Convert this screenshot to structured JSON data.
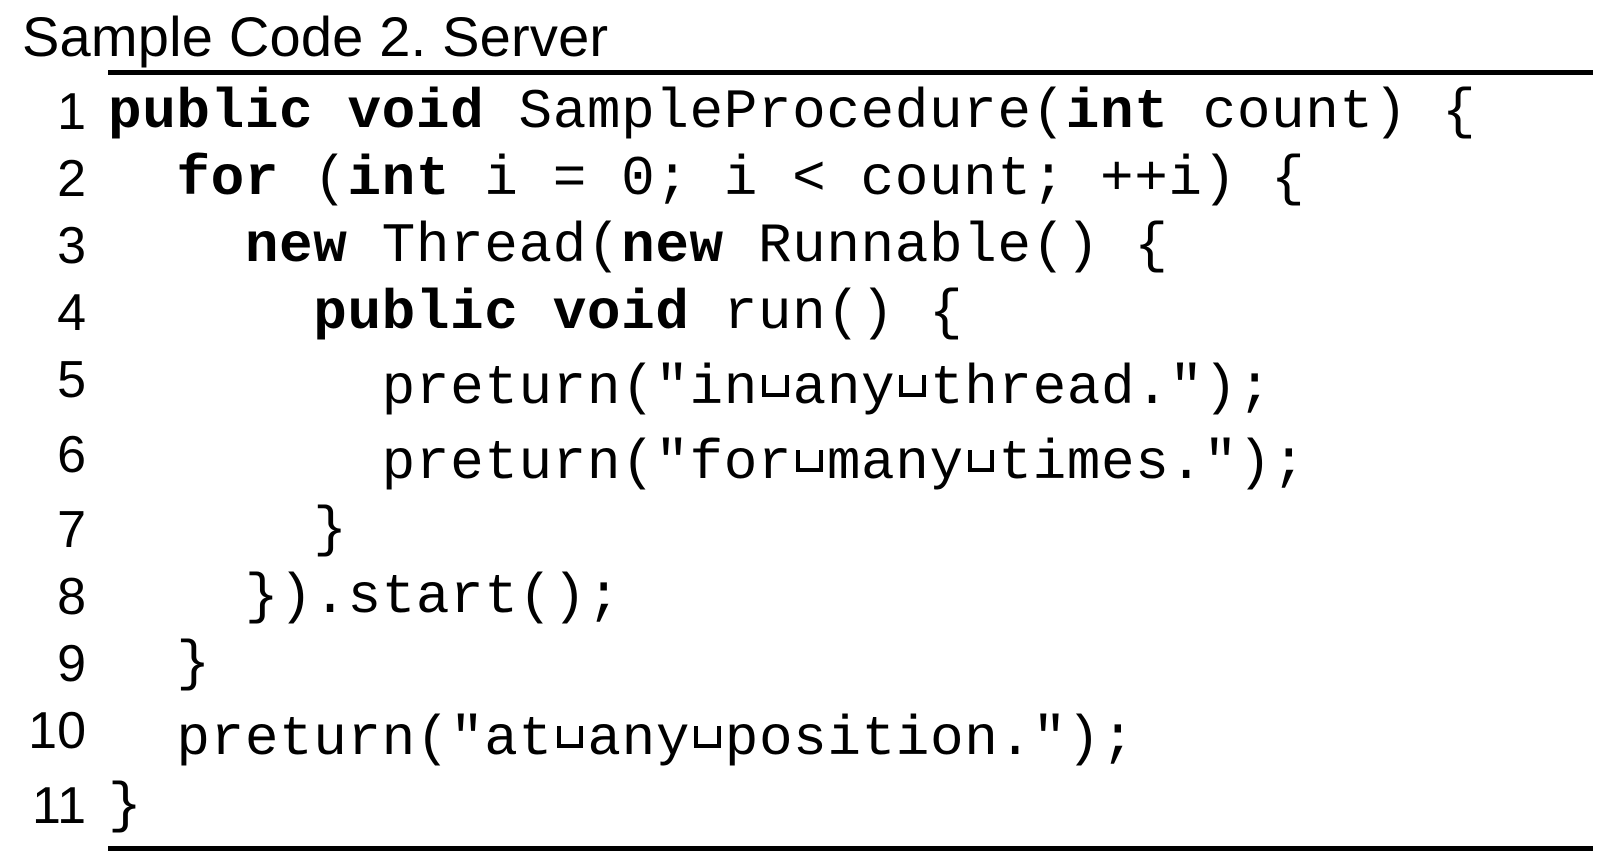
{
  "caption": "Sample Code 2.  Server",
  "code": {
    "lines": [
      {
        "n": 1,
        "indent": 0,
        "tokens": [
          {
            "t": "public",
            "kw": true
          },
          {
            "t": " "
          },
          {
            "t": "void",
            "kw": true
          },
          {
            "t": " SampleProcedure("
          },
          {
            "t": "int",
            "kw": true
          },
          {
            "t": " count) {"
          }
        ]
      },
      {
        "n": 2,
        "indent": 1,
        "tokens": [
          {
            "t": "for",
            "kw": true
          },
          {
            "t": " ("
          },
          {
            "t": "int",
            "kw": true
          },
          {
            "t": " i = 0; i < count; ++i) {"
          }
        ]
      },
      {
        "n": 3,
        "indent": 2,
        "tokens": [
          {
            "t": "new",
            "kw": true
          },
          {
            "t": " Thread("
          },
          {
            "t": "new",
            "kw": true
          },
          {
            "t": " Runnable() {"
          }
        ]
      },
      {
        "n": 4,
        "indent": 3,
        "tokens": [
          {
            "t": "public",
            "kw": true
          },
          {
            "t": " "
          },
          {
            "t": "void",
            "kw": true
          },
          {
            "t": " run() {"
          }
        ]
      },
      {
        "n": 5,
        "indent": 4,
        "tokens": [
          {
            "t": "preturn(\"in"
          },
          {
            "vsp": true
          },
          {
            "t": "any"
          },
          {
            "vsp": true
          },
          {
            "t": "thread.\");"
          }
        ]
      },
      {
        "n": 6,
        "indent": 4,
        "tokens": [
          {
            "t": "preturn(\"for"
          },
          {
            "vsp": true
          },
          {
            "t": "many"
          },
          {
            "vsp": true
          },
          {
            "t": "times.\");"
          }
        ]
      },
      {
        "n": 7,
        "indent": 3,
        "tokens": [
          {
            "t": "}"
          }
        ]
      },
      {
        "n": 8,
        "indent": 2,
        "tokens": [
          {
            "t": "}).start();"
          }
        ]
      },
      {
        "n": 9,
        "indent": 1,
        "tokens": [
          {
            "t": "}"
          }
        ]
      },
      {
        "n": 10,
        "indent": 1,
        "tokens": [
          {
            "t": "preturn(\"at"
          },
          {
            "vsp": true
          },
          {
            "t": "any"
          },
          {
            "vsp": true
          },
          {
            "t": "position.\");"
          }
        ]
      },
      {
        "n": 11,
        "indent": 0,
        "tokens": [
          {
            "t": "}"
          }
        ]
      }
    ],
    "indent_unit": "  "
  }
}
